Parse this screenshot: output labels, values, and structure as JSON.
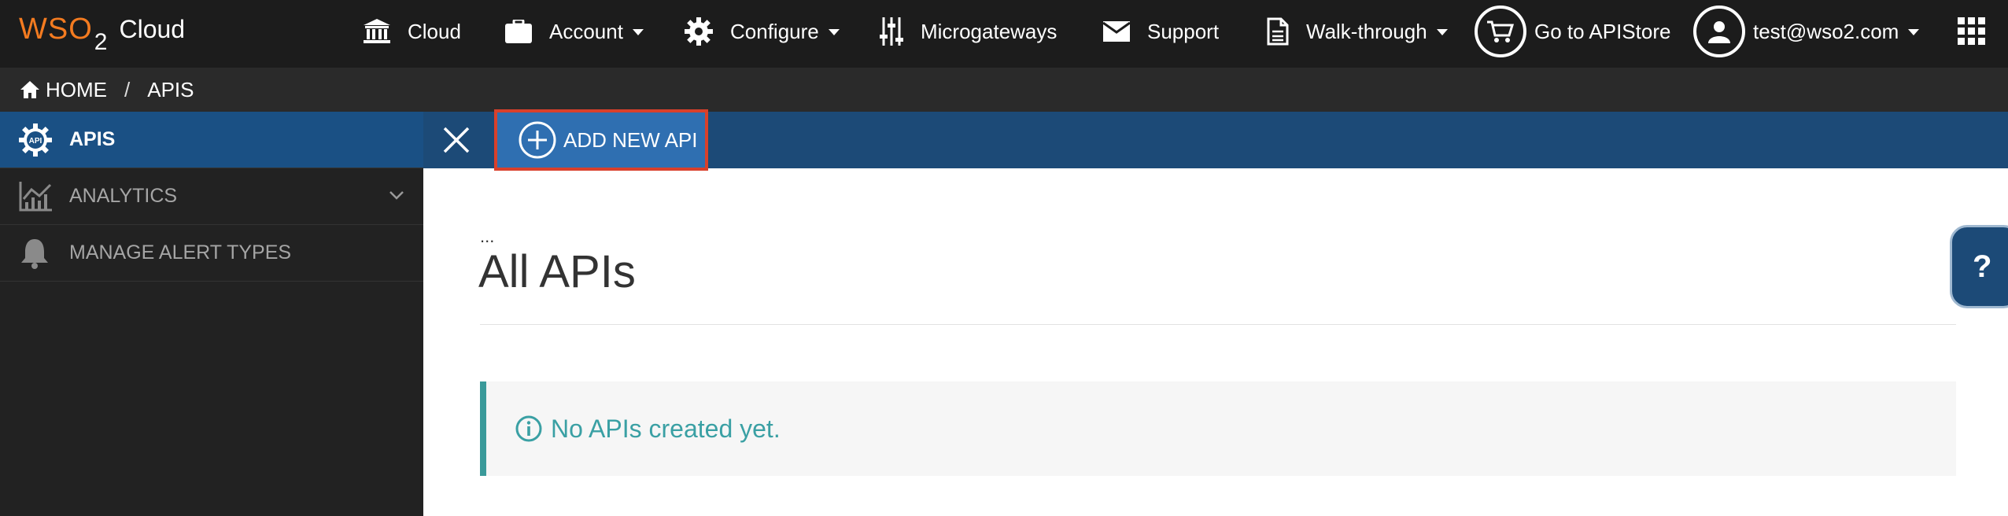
{
  "header": {
    "logo_text": "WSO",
    "logo_sub": "2",
    "logo_cloud": "Cloud",
    "nav": {
      "cloud": "Cloud",
      "account": "Account",
      "configure": "Configure",
      "microgateways": "Microgateways",
      "support": "Support",
      "walkthrough": "Walk-through",
      "apistore": "Go to APIStore",
      "user": "test@wso2.com"
    }
  },
  "breadcrumb": {
    "home": "HOME",
    "separator": "/",
    "current": "APIS"
  },
  "sidebar": {
    "items": [
      {
        "label": "APIS",
        "icon": "api-gear-icon",
        "active": true
      },
      {
        "label": "ANALYTICS",
        "icon": "analytics-chart-icon",
        "active": false
      },
      {
        "label": "MANAGE ALERT TYPES",
        "icon": "bell-icon",
        "active": false
      }
    ]
  },
  "toolbar": {
    "add_new_api": "ADD NEW API"
  },
  "main": {
    "dots": "...",
    "title": "All APIs",
    "empty_message": "No APIs created yet."
  },
  "help": {
    "label": "?"
  },
  "colors": {
    "topbar": "#1c1c1c",
    "accent_orange": "#f47b20",
    "sidebar_active": "#1a5084",
    "actionbar": "#1c4a77",
    "add_button": "#2f6fb1",
    "highlight_border": "#d9402b",
    "notice_text": "#3aa0a4"
  }
}
